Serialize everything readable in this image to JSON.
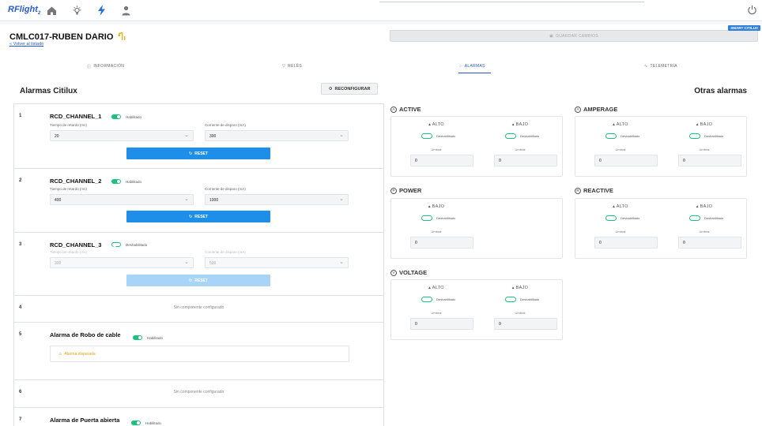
{
  "topbar": {
    "logo": "RFlight",
    "logo_sub": "2",
    "nav_icons": [
      "home-icon",
      "bulb-icon",
      "bolt-icon",
      "user-icon"
    ],
    "power_icon": "power-icon",
    "badge": "SMART CITILUX"
  },
  "device": {
    "title": "CMLC017-RUBEN DARIO",
    "back_link": "« Volver al listado",
    "save_label": "GUARDAR CAMBIOS"
  },
  "tabs": [
    {
      "label": "INFORMACIÓN",
      "icon": "info-icon"
    },
    {
      "label": "RELÉS",
      "icon": "filter-icon"
    },
    {
      "label": "ALARMAS",
      "icon": "bell-icon",
      "active": true
    },
    {
      "label": "TELEMETRÍA",
      "icon": "pulse-icon"
    }
  ],
  "left": {
    "title": "Alarmas Citilux",
    "reconfig_label": "RECONFIGURAR",
    "rows": [
      {
        "num": "1",
        "name": "RCD_CHANNEL_1",
        "status": "Habilitado",
        "enabled": true,
        "l1": "Tiempo de retardo (ms)",
        "v1": "20",
        "l2": "Corriente de disparo (mA)",
        "v2": "300",
        "reset": "RESET"
      },
      {
        "num": "2",
        "name": "RCD_CHANNEL_2",
        "status": "Habilitado",
        "enabled": true,
        "l1": "Tiempo de retardo (ms)",
        "v1": "400",
        "l2": "Corriente de disparo (mA)",
        "v2": "1000",
        "reset": "RESET"
      },
      {
        "num": "3",
        "name": "RCD_CHANNEL_3",
        "status": "Deshabilitado",
        "enabled": false,
        "l1": "Tiempo de retardo (ms)",
        "v1": "300",
        "l2": "Corriente de disparo (mA)",
        "v2": "500",
        "reset": "RESET"
      },
      {
        "num": "4",
        "empty": "Sin componente configurado"
      },
      {
        "num": "5",
        "name": "Alarma de Robo de cable",
        "status": "Habilitado",
        "warning": "Alarma disparada"
      },
      {
        "num": "6",
        "empty": "Sin componente configurado"
      },
      {
        "num": "7",
        "name": "Alarma de Puerta abierta",
        "status": "Habilitado"
      }
    ]
  },
  "right": {
    "title": "Otras alarmas",
    "cards": [
      {
        "name": "ACTIVE",
        "icon": "A",
        "cols": [
          {
            "head": "ALTO",
            "status": "Deshabilitado",
            "umbral": "Umbral",
            "value": "0"
          },
          {
            "head": "BAJO",
            "status": "Deshabilitado",
            "umbral": "Umbral",
            "value": "0"
          }
        ]
      },
      {
        "name": "AMPERAGE",
        "icon": "A",
        "cols": [
          {
            "head": "ALTO",
            "status": "Deshabilitado",
            "umbral": "Umbral",
            "value": "0"
          },
          {
            "head": "BAJO",
            "status": "Deshabilitado",
            "umbral": "Umbral",
            "value": "0"
          }
        ]
      },
      {
        "name": "POWER",
        "icon": "P",
        "cols": [
          {
            "head": "BAJO",
            "status": "Deshabilitado",
            "umbral": "Umbral",
            "value": "0"
          }
        ]
      },
      {
        "name": "REACTIVE",
        "icon": "R",
        "cols": [
          {
            "head": "ALTO",
            "status": "Deshabilitado",
            "umbral": "Umbral",
            "value": "0"
          },
          {
            "head": "BAJO",
            "status": "Deshabilitado",
            "umbral": "Umbral",
            "value": "0"
          }
        ]
      },
      {
        "name": "VOLTAGE",
        "icon": "V",
        "cols": [
          {
            "head": "ALTO",
            "status": "Deshabilitado",
            "umbral": "Umbral",
            "value": "0"
          },
          {
            "head": "BAJO",
            "status": "Deshabilitado",
            "umbral": "Umbral",
            "value": "0"
          }
        ]
      }
    ]
  },
  "colors": {
    "accent": "#1f56c9",
    "reset": "#1e8fe8",
    "toggle": "#19c37d",
    "warning": "#e6a01a"
  }
}
